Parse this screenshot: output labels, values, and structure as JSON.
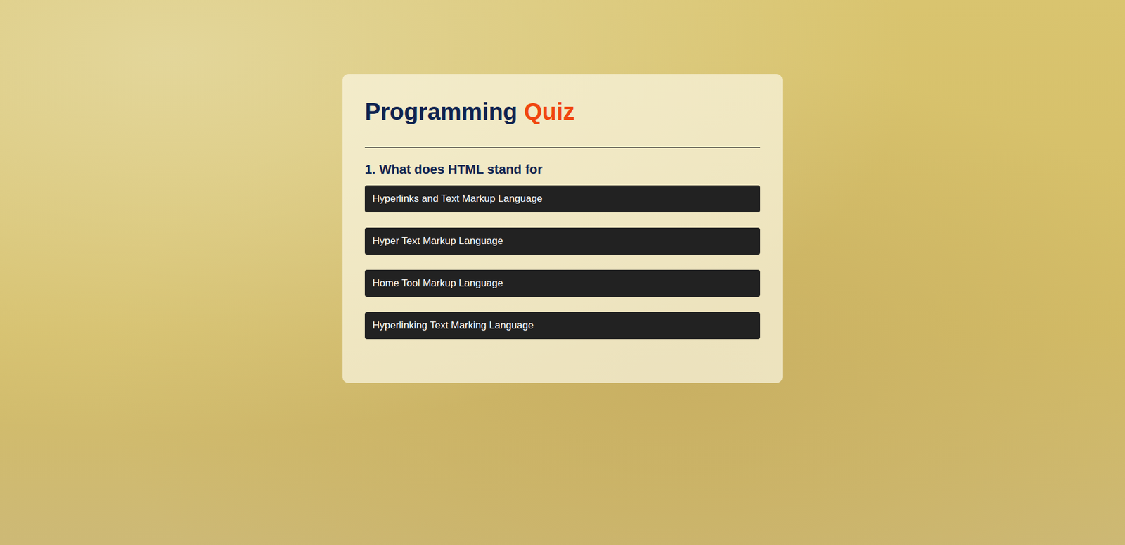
{
  "page": {
    "title": {
      "text": "Programming",
      "accent": "Quiz"
    }
  },
  "question": {
    "text": "1. What does HTML stand for"
  },
  "answers": [
    {
      "label": "Hyperlinks and Text Markup Language"
    },
    {
      "label": "Hyper Text Markup Language"
    },
    {
      "label": "Home Tool Markup Language"
    },
    {
      "label": "Hyperlinking Text Marking Language"
    }
  ]
}
